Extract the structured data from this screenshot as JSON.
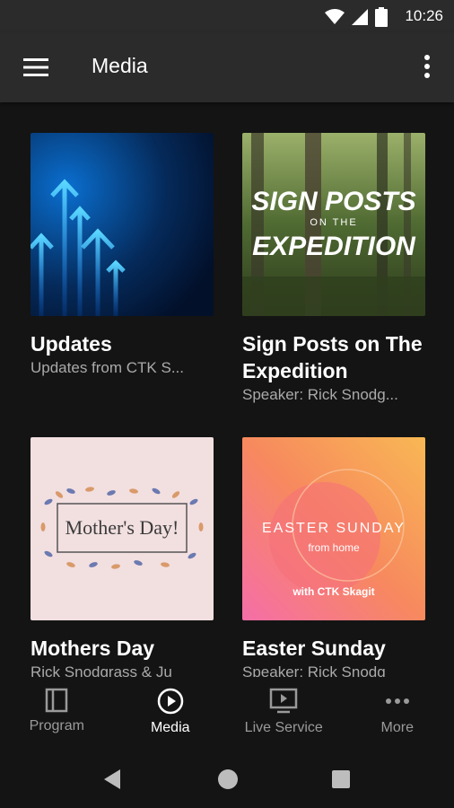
{
  "status_bar": {
    "time": "10:26"
  },
  "app_bar": {
    "title": "Media"
  },
  "cards": [
    {
      "title": "Updates",
      "subtitle": "Updates from CTK S..."
    },
    {
      "title": "Sign Posts on The Expedition",
      "subtitle": "Speaker: Rick Snodg...",
      "art_line1": "SIGN POSTS",
      "art_line2": "ON THE",
      "art_line3": "EXPEDITION"
    },
    {
      "title": "Mothers Day",
      "subtitle": "Rick Snodgrass & Ju",
      "art_text": "Mother's Day!"
    },
    {
      "title": "Easter Sunday",
      "subtitle": "Speaker: Rick Snodg",
      "art_line1": "EASTER SUNDAY",
      "art_line2": "from home",
      "art_line3": "with CTK Skagit"
    }
  ],
  "bottom_nav": [
    {
      "label": "Program",
      "icon": "program-icon",
      "active": false
    },
    {
      "label": "Media",
      "icon": "play-circle-icon",
      "active": true
    },
    {
      "label": "Live Service",
      "icon": "tv-play-icon",
      "active": false
    },
    {
      "label": "More",
      "icon": "more-horizontal-icon",
      "active": false
    }
  ],
  "colors": {
    "app_bar": "#2b2b2b",
    "background": "#141414",
    "active": "#ffffff",
    "inactive": "#9a9a9a"
  }
}
